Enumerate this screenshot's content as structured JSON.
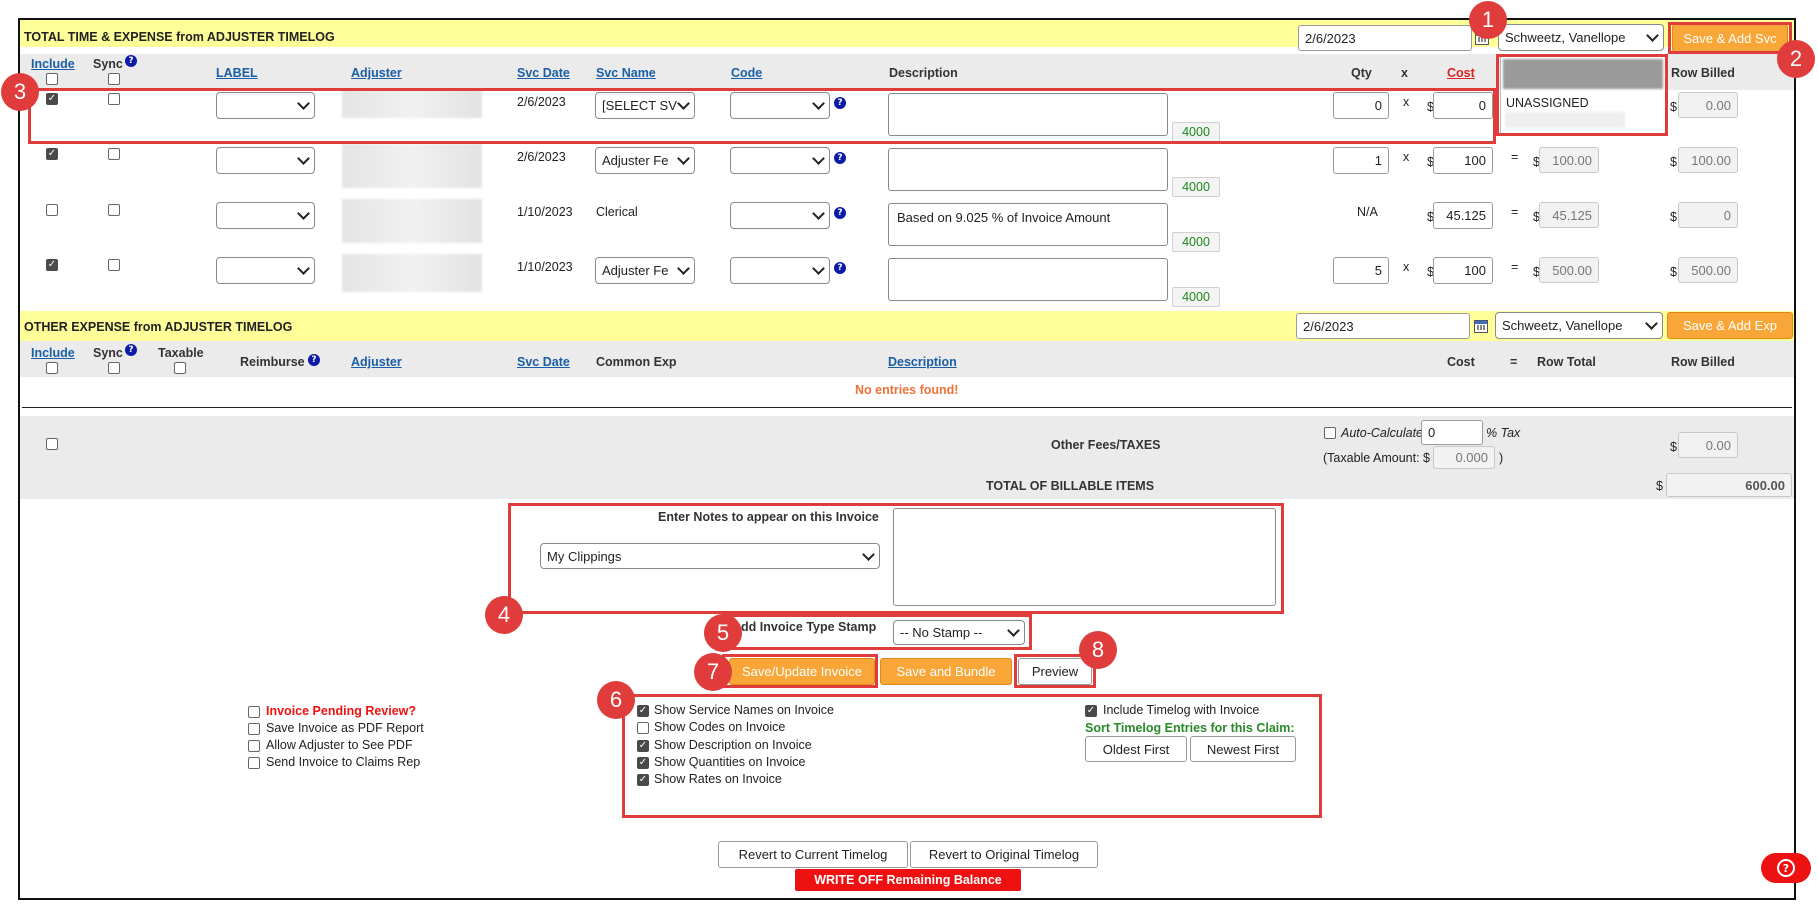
{
  "svc_section": {
    "title": "TOTAL TIME & EXPENSE from ADJUSTER TIMELOG",
    "date": "2/6/2023",
    "adjuster": "Schweetz, Vanellope",
    "save_button": "Save & Add Svc",
    "headers": {
      "include": "Include",
      "sync": "Sync",
      "label": "LABEL",
      "adjuster": "Adjuster",
      "svc_date": "Svc Date",
      "svc_name": "Svc Name",
      "code": "Code",
      "description": "Description",
      "qty": "Qty",
      "x": "x",
      "cost": "Cost",
      "row_billed": "Row Billed"
    },
    "rows": [
      {
        "include": true,
        "svc_date": "2/6/2023",
        "svc_name": "[SELECT SV",
        "description": "",
        "code_tag": "4000",
        "qty": "0",
        "x": "x",
        "dollar": "$",
        "cost": "0",
        "row_billed": "0.00"
      },
      {
        "include": true,
        "svc_date": "2/6/2023",
        "svc_name": "Adjuster Fe",
        "description": "",
        "code_tag": "4000",
        "qty": "1",
        "x": "x",
        "dollar": "$",
        "cost": "100",
        "eq": "=",
        "row_total": "100.00",
        "row_billed": "100.00"
      },
      {
        "include": false,
        "svc_date": "1/10/2023",
        "svc_name": "Clerical",
        "description": "Based on 9.025 % of Invoice Amount",
        "code_tag": "4000",
        "qty": "N/A",
        "dollar": "$",
        "cost": "45.125",
        "eq": "=",
        "row_total": "45.125",
        "row_billed": "0"
      },
      {
        "include": true,
        "svc_date": "1/10/2023",
        "svc_name": "Adjuster Fe",
        "description": "",
        "code_tag": "4000",
        "qty": "5",
        "x": "x",
        "dollar": "$",
        "cost": "100",
        "eq": "=",
        "row_total": "500.00",
        "row_billed": "500.00"
      }
    ],
    "dropdown_option": "UNASSIGNED"
  },
  "exp_section": {
    "title": "OTHER EXPENSE from ADJUSTER TIMELOG",
    "date": "2/6/2023",
    "adjuster": "Schweetz, Vanellope",
    "save_button": "Save & Add Exp",
    "headers": {
      "include": "Include",
      "sync": "Sync",
      "taxable": "Taxable",
      "reimburse": "Reimburse",
      "adjuster": "Adjuster",
      "svc_date": "Svc Date",
      "common_exp": "Common Exp",
      "description": "Description",
      "cost": "Cost",
      "eq": "=",
      "row_total": "Row Total",
      "row_billed": "Row Billed"
    },
    "empty_message": "No entries found!"
  },
  "fees": {
    "label": "Other Fees/TAXES",
    "auto_calc": "Auto-Calculate",
    "tax_value": "0",
    "tax_suffix": "% Tax",
    "taxable_prefix": "(Taxable Amount: $",
    "taxable_value": "0.000",
    "taxable_suffix": ")",
    "dollar": "$",
    "fee_value": "0.00",
    "total_label": "TOTAL OF BILLABLE ITEMS",
    "total_value": "600.00"
  },
  "notes": {
    "label": "Enter Notes to appear on this Invoice",
    "clippings": "My Clippings",
    "stamp_label": "Add Invoice Type Stamp",
    "stamp_value": "-- No Stamp --"
  },
  "buttons": {
    "save_update": "Save/Update Invoice",
    "save_bundle": "Save and Bundle",
    "preview": "Preview",
    "revert_current": "Revert to Current Timelog",
    "revert_original": "Revert to Original Timelog",
    "write_off": "WRITE OFF Remaining Balance",
    "oldest": "Oldest First",
    "newest": "Newest First"
  },
  "left_options": [
    {
      "label": "Invoice Pending Review?",
      "checked": false,
      "highlight": true
    },
    {
      "label": "Save Invoice as PDF Report",
      "checked": false
    },
    {
      "label": "Allow Adjuster to See PDF",
      "checked": false
    },
    {
      "label": "Send Invoice to Claims Rep",
      "checked": false
    }
  ],
  "show_options": [
    {
      "label": "Show Service Names on Invoice",
      "checked": true
    },
    {
      "label": "Show Codes on Invoice",
      "checked": false
    },
    {
      "label": "Show Description on Invoice",
      "checked": true
    },
    {
      "label": "Show Quantities on Invoice",
      "checked": true
    },
    {
      "label": "Show Rates on Invoice",
      "checked": true
    }
  ],
  "timelog": {
    "include_label": "Include Timelog with Invoice",
    "sort_label": "Sort Timelog Entries for this Claim:"
  },
  "callouts": [
    "1",
    "2",
    "3",
    "4",
    "5",
    "6",
    "7",
    "8"
  ],
  "colors": {
    "accent_orange": "#f7a637",
    "callout_red": "#e03c3c",
    "band_yellow": "#ffff99",
    "link_blue": "#1a5ea8",
    "code_green": "#1a8a1a",
    "warning_red": "#ee1111"
  }
}
